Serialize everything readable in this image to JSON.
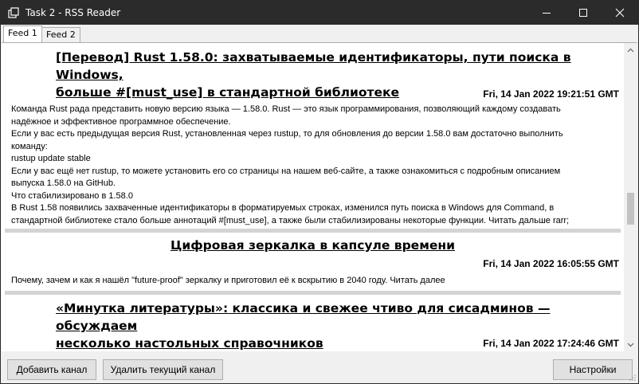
{
  "window": {
    "title": "Task 2 - RSS Reader"
  },
  "tabs": [
    {
      "label": "Feed 1",
      "active": true
    },
    {
      "label": "Feed 2",
      "active": false
    }
  ],
  "articles": [
    {
      "title_lines": [
        "[Перевод] Rust 1.58.0: захватываемые идентификаторы, пути поиска в Windows,",
        "больше #[must_use] в стандартной библиотеке"
      ],
      "date": "Fri, 14 Jan 2022 19:21:51 GMT",
      "body_lines": [
        "Команда Rust рада представить новую версию языка — 1.58.0. Rust — это язык программирования, позволяющий каждому создавать",
        "надёжное и эффективное программное обеспечение.",
        "Если у вас есть предыдущая версия Rust, установленная через rustup, то для обновления до версии 1.58.0 вам достаточно выполнить",
        "команду:",
        "rustup update stable",
        "Если у вас ещё нет rustup, то можете установить его со страницы на нашем веб-сайте, а также ознакомиться с подробным описанием",
        "выпуска 1.58.0 на GitHub.",
        "Что стабилизировано в 1.58.0",
        "В Rust 1.58 появились захваченные идентификаторы в форматируемых строках, изменился путь поиска в Windows для Command, в",
        "стандартной библиотеке стало больше аннотаций #[must_use], а также были стабилизированы некоторые функции. Читать дальше rarr;"
      ]
    },
    {
      "title_lines": [
        "Цифровая зеркалка в капсуле времени"
      ],
      "date": "Fri, 14 Jan 2022 16:05:55 GMT",
      "body_lines": [
        "Почему, зачем и как я нашёл \"future-proof\" зеркалку и приготовил её к вскрытию в 2040 году. Читать далее"
      ]
    },
    {
      "title_lines": [
        "«Минутка литературы»: классика и свежее чтиво для сисадминов — обсуждаем",
        "несколько настольных справочников"
      ],
      "date": "Fri, 14 Jan 2022 17:24:46 GMT",
      "body_lines": []
    }
  ],
  "buttons": {
    "add_feed": "Добавить канал",
    "remove_feed": "Удалить текущий канал",
    "settings": "Настройки"
  },
  "colors": {
    "titlebar": "#2b2b2b",
    "content_bg": "#ffffff",
    "separator": "#d4d4d4",
    "scroll_thumb": "#c2c2c2"
  }
}
